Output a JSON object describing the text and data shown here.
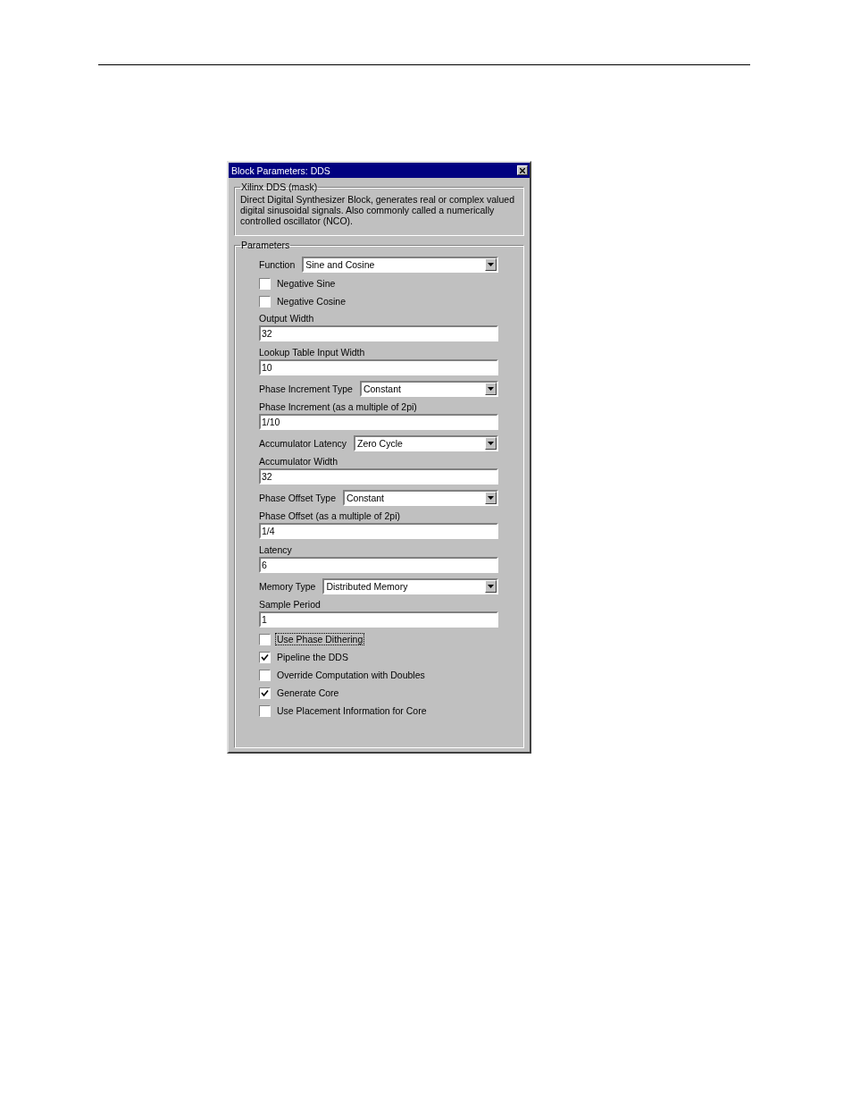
{
  "window": {
    "title": "Block Parameters: DDS"
  },
  "mask": {
    "title": "Xilinx DDS (mask)",
    "description": "Direct Digital Synthesizer Block, generates real or complex valued digital sinusoidal signals.  Also commonly called a numerically controlled oscillator (NCO)."
  },
  "parameters": {
    "title": "Parameters",
    "items": [
      {
        "kind": "select",
        "label": "Function",
        "value": "Sine and Cosine"
      },
      {
        "kind": "checkbox",
        "label": "Negative Sine",
        "checked": false,
        "focused": false
      },
      {
        "kind": "checkbox",
        "label": "Negative Cosine",
        "checked": false,
        "focused": false
      },
      {
        "kind": "text",
        "label": "Output Width",
        "value": "32"
      },
      {
        "kind": "text",
        "label": "Lookup Table Input Width",
        "value": "10"
      },
      {
        "kind": "select",
        "label": "Phase Increment Type",
        "value": "Constant"
      },
      {
        "kind": "text",
        "label": "Phase Increment  (as a multiple of 2pi)",
        "value": "1/10"
      },
      {
        "kind": "select",
        "label": "Accumulator Latency",
        "value": "Zero Cycle"
      },
      {
        "kind": "text",
        "label": "Accumulator Width",
        "value": "32"
      },
      {
        "kind": "select",
        "label": "Phase Offset Type",
        "value": "Constant"
      },
      {
        "kind": "text",
        "label": "Phase Offset  (as a multiple of 2pi)",
        "value": "1/4"
      },
      {
        "kind": "text",
        "label": "Latency",
        "value": "6"
      },
      {
        "kind": "select",
        "label": "Memory Type",
        "value": "Distributed Memory"
      },
      {
        "kind": "text",
        "label": "Sample Period",
        "value": "1"
      },
      {
        "kind": "checkbox",
        "label": "Use Phase Dithering",
        "checked": false,
        "focused": true
      },
      {
        "kind": "checkbox",
        "label": "Pipeline the DDS",
        "checked": true,
        "focused": false
      },
      {
        "kind": "checkbox",
        "label": "Override Computation with Doubles",
        "checked": false,
        "focused": false
      },
      {
        "kind": "checkbox",
        "label": "Generate Core",
        "checked": true,
        "focused": false
      },
      {
        "kind": "checkbox",
        "label": "Use Placement Information for Core",
        "checked": false,
        "focused": false
      }
    ]
  }
}
